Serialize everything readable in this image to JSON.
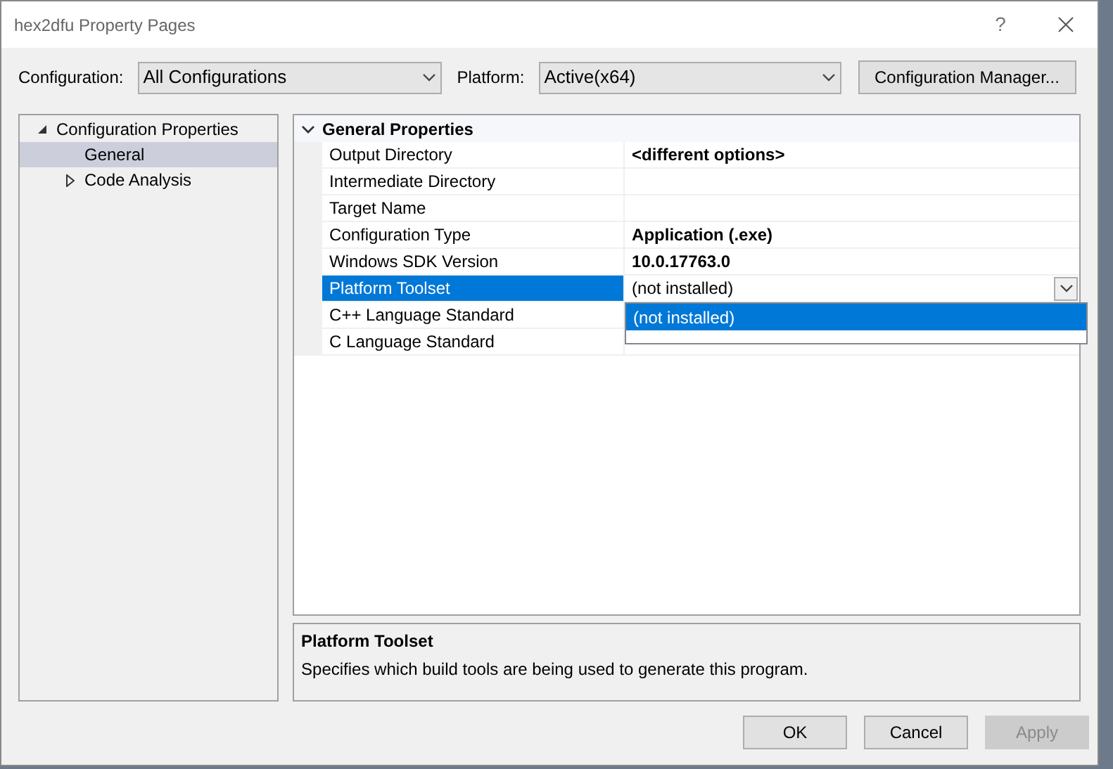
{
  "window": {
    "title": "hex2dfu Property Pages",
    "help": "?"
  },
  "toolbar": {
    "configuration_label": "Configuration:",
    "configuration_value": "All Configurations",
    "platform_label": "Platform:",
    "platform_value": "Active(x64)",
    "manager_button": "Configuration Manager..."
  },
  "tree": [
    {
      "label": "Configuration Properties",
      "expanded": true,
      "selected": false,
      "children": [
        {
          "label": "General",
          "selected": true
        },
        {
          "label": "Code Analysis",
          "selected": false,
          "expanded": false
        }
      ]
    }
  ],
  "grid": {
    "category": "General Properties",
    "expanded": true,
    "rows": [
      {
        "name": "Output Directory",
        "value": "<different options>",
        "modified": true,
        "selected": false
      },
      {
        "name": "Intermediate Directory",
        "selected": false
      },
      {
        "name": "Target Name",
        "selected": false
      },
      {
        "name": "Configuration Type",
        "value": "Application (.exe)",
        "modified": true,
        "selected": false
      },
      {
        "name": "Windows SDK Version",
        "value": "10.0.17763.0",
        "modified": true,
        "selected": false
      },
      {
        "name": "Platform Toolset",
        "value": "(not installed)",
        "modified": false,
        "selected": true,
        "dropdown": {
          "open": true,
          "options": [
            {
              "label": "(not installed)",
              "selected": true
            }
          ]
        }
      },
      {
        "name": "C++ Language Standard",
        "selected": false
      },
      {
        "name": "C Language Standard",
        "selected": false
      }
    ]
  },
  "description": {
    "title": "Platform Toolset",
    "text": "Specifies which build tools are being used to generate this program."
  },
  "buttons": [
    {
      "label": "OK",
      "disabled": false
    },
    {
      "label": "Cancel",
      "disabled": false
    },
    {
      "label": "Apply",
      "disabled": true
    }
  ]
}
